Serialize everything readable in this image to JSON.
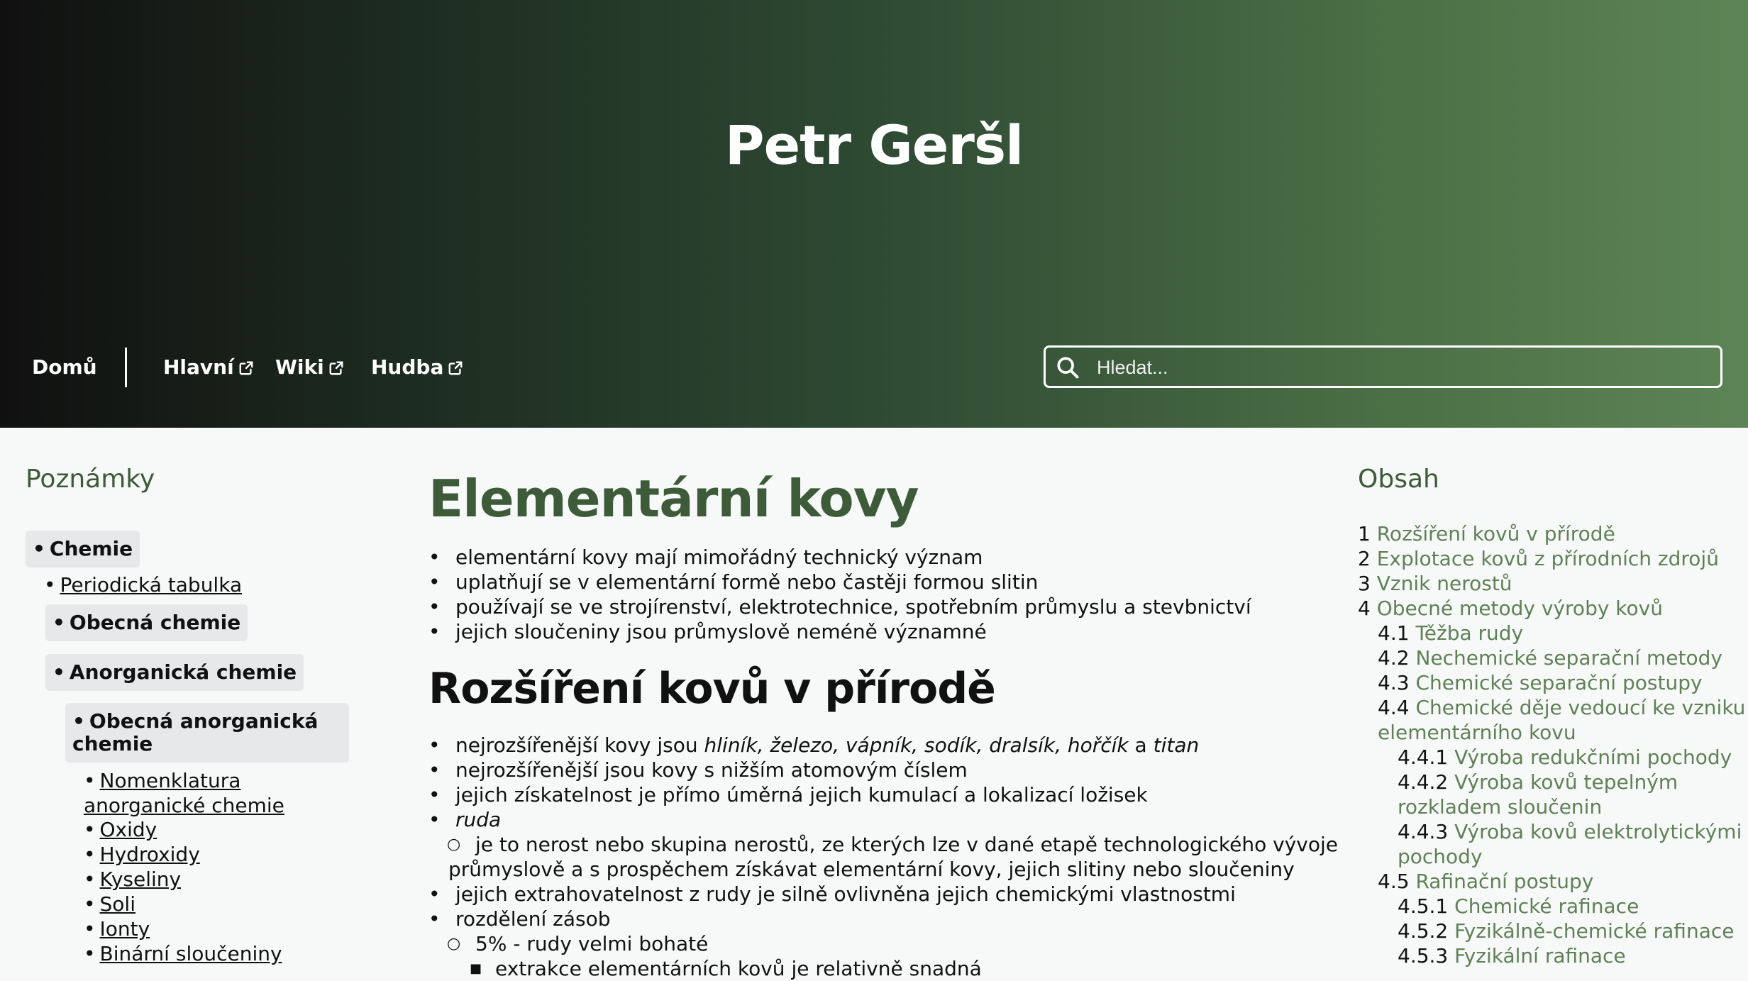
{
  "header": {
    "site_title": "Petr Geršl",
    "nav": [
      {
        "label": "Domů",
        "external": false
      },
      {
        "label": "Hlavní",
        "external": true
      },
      {
        "label": "Wiki",
        "external": true
      },
      {
        "label": "Hudba",
        "external": true
      }
    ],
    "search_placeholder": "Hledat..."
  },
  "left_sidebar": {
    "heading": "Poznámky",
    "items": [
      {
        "label": "Chemie",
        "style": "pill"
      },
      {
        "label": "Periodická tabulka",
        "style": "link"
      },
      {
        "label": "Obecná chemie",
        "style": "pill"
      },
      {
        "label": "Anorganická chemie",
        "style": "pill"
      },
      {
        "label": "Obecná anorganická chemie",
        "style": "pill"
      },
      {
        "label": "Nomenklatura anorganické chemie",
        "style": "link"
      },
      {
        "label": "Oxidy",
        "style": "link"
      },
      {
        "label": "Hydroxidy",
        "style": "link"
      },
      {
        "label": "Kyseliny",
        "style": "link"
      },
      {
        "label": "Soli",
        "style": "link"
      },
      {
        "label": "Ionty",
        "style": "link"
      },
      {
        "label": "Binární sloučeniny",
        "style": "link"
      }
    ]
  },
  "main": {
    "title": "Elementární kovy",
    "intro": [
      "elementární kovy mají mimořádný technický význam",
      "uplatňují se v elementární formě nebo častěji formou slitin",
      "používají se ve strojírenství, elektrotechnice, spotřebním průmyslu a stevbnictví",
      "jejich sloučeniny jsou průmyslově neméně významné"
    ],
    "section1_title": "Rozšíření kovů v přírodě",
    "s1_b1_prefix": "nejrozšířenější kovy jsou ",
    "s1_b1_italic": "hliník, železo, vápník, sodík, dralsík, hořčík",
    "s1_b1_and": " a ",
    "s1_b1_italic2": "titan",
    "s1_b2": "nejrozšířenější jsou kovy s nižším atomovým číslem",
    "s1_b3": "jejich získatelnost je přímo úměrná jejich kumulací a lokalizací ložisek",
    "s1_b4": "ruda",
    "s1_b4_sub_line1": "je to nerost nebo skupina nerostů, ze kterých lze v dané etapě technologického vývoje",
    "s1_b4_sub_line2": "průmyslově a s prospěchem získávat elementární kovy, jejich slitiny nebo sloučeniny",
    "s1_b5": "jejich extrahovatelnost z rudy je silně ovlivněna jejich chemickými vlastnostmi",
    "s1_b6": "rozdělení zásob",
    "s1_b6_sub1": "5% - rudy velmi bohaté",
    "s1_b6_sub1_sub1": "extrakce elementárních kovů je relativně snadná"
  },
  "toc": {
    "heading": "Obsah",
    "items": [
      {
        "num": "1",
        "label": "Rozšíření kovů v přírodě",
        "level": 0
      },
      {
        "num": "2",
        "label": "Explotace kovů z přírodních zdrojů",
        "level": 0
      },
      {
        "num": "3",
        "label": "Vznik nerostů",
        "level": 0
      },
      {
        "num": "4",
        "label": "Obecné metody výroby kovů",
        "level": 0
      },
      {
        "num": "4.1",
        "label": "Těžba rudy",
        "level": 1
      },
      {
        "num": "4.2",
        "label": "Nechemické separační metody",
        "level": 1
      },
      {
        "num": "4.3",
        "label": "Chemické separační postupy",
        "level": 1
      },
      {
        "num": "4.4",
        "label": "Chemické děje vedoucí ke vzniku",
        "label2": "elementárního kovu",
        "level": 1
      },
      {
        "num": "4.4.1",
        "label": "Výroba redukčními pochody",
        "level": 2
      },
      {
        "num": "4.4.2",
        "label": "Výroba kovů tepelným",
        "label2": "rozkladem sloučenin",
        "level": 2
      },
      {
        "num": "4.4.3",
        "label": "Výroba kovů elektrolytickými",
        "label2": "pochody",
        "level": 2
      },
      {
        "num": "4.5",
        "label": "Rafinační postupy",
        "level": 1
      },
      {
        "num": "4.5.1",
        "label": "Chemické rafinace",
        "level": 2
      },
      {
        "num": "4.5.2",
        "label": "Fyzikálně-chemické rafinace",
        "level": 2
      },
      {
        "num": "4.5.3",
        "label": "Fyzikální rafinace",
        "level": 2
      }
    ]
  },
  "colors": {
    "accent_green": "#3d5b38",
    "link_green": "#5f8156",
    "pill_bg": "#e6e8e9"
  }
}
